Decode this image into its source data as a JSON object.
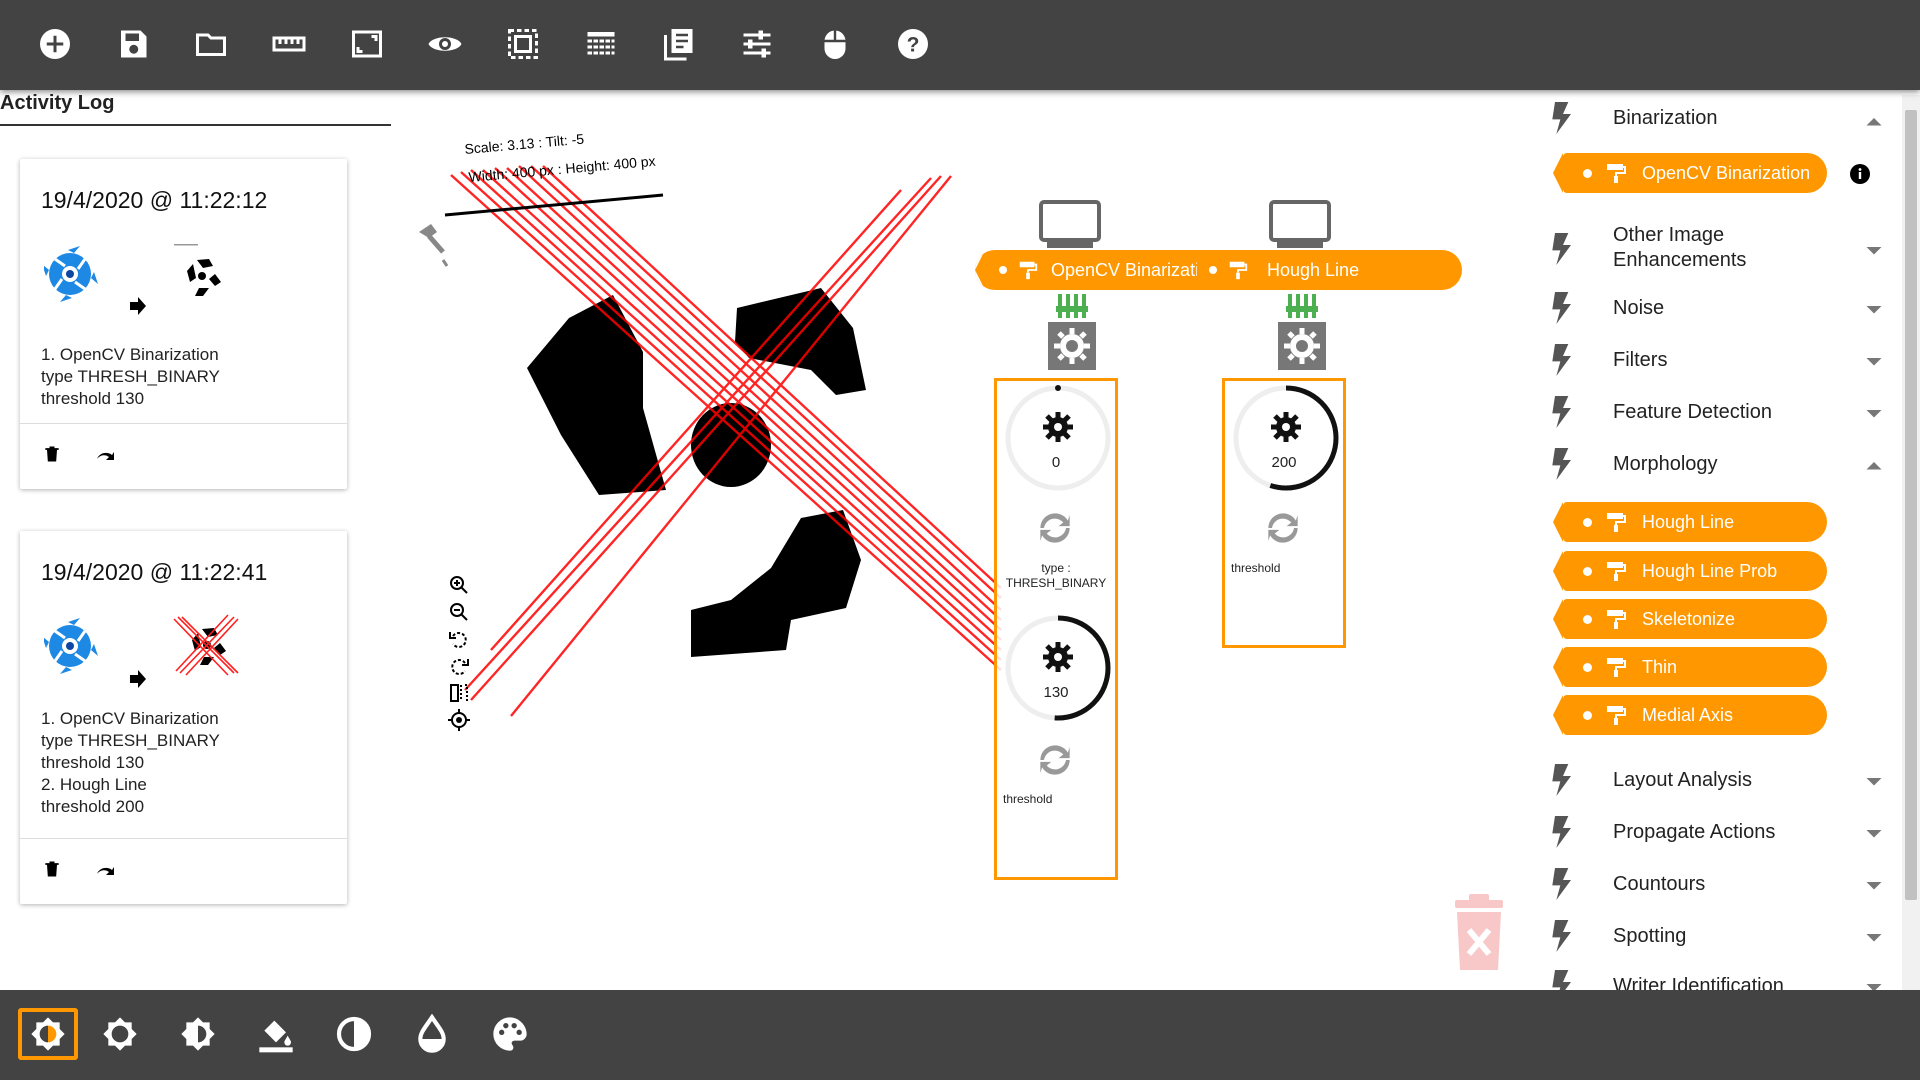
{
  "colors": {
    "accent": "#ff9800",
    "toolbar": "#434343",
    "connector": "#4caf50",
    "lines": "#ff0000"
  },
  "toolbar": {
    "icons": [
      "add-circle",
      "save",
      "folder",
      "ruler",
      "crop-frame",
      "eye",
      "select-dashed",
      "layers-lines",
      "document-list",
      "tune-sliders",
      "mouse",
      "help-circle"
    ]
  },
  "activity_log": {
    "title": "Activity Log",
    "entries": [
      {
        "date": "19/4/2020 @ 11:22:12",
        "steps": [
          "1. OpenCV Binarization",
          "type THRESH_BINARY",
          "threshold 130"
        ]
      },
      {
        "date": "19/4/2020 @ 11:22:41",
        "steps": [
          "1. OpenCV Binarization",
          "type THRESH_BINARY",
          "threshold 130",
          "2. Hough Line",
          "threshold 200"
        ]
      }
    ]
  },
  "canvas": {
    "scale_info_line1": "Scale: 3.13 : Tilt: -5",
    "scale_info_line2": "Width: 400 px : Height: 400 px",
    "pipeline": [
      {
        "label": "OpenCV Binarizatic",
        "params": [
          {
            "value": "0",
            "fraction": 0.0,
            "label_line1": "type :",
            "label_line2": "THRESH_BINARY"
          },
          {
            "value": "130",
            "fraction": 0.51,
            "label_line1": "threshold",
            "label_line2": ""
          }
        ]
      },
      {
        "label": "Hough Line",
        "params": [
          {
            "value": "200",
            "fraction": 0.55,
            "label_line1": "threshold",
            "label_line2": ""
          }
        ]
      }
    ],
    "zoom_tools": [
      "zoom-in",
      "zoom-out",
      "rotate-left",
      "rotate-right",
      "flip",
      "center-target"
    ]
  },
  "sidebar": {
    "categories": [
      {
        "name": "Binarization",
        "expanded": true,
        "items": [
          "OpenCV Binarization"
        ]
      },
      {
        "name": "Other Image Enhancements",
        "line1": "Other Image",
        "line2": "Enhancements",
        "expanded": false
      },
      {
        "name": "Noise",
        "expanded": false
      },
      {
        "name": "Filters",
        "expanded": false
      },
      {
        "name": "Feature Detection",
        "expanded": false
      },
      {
        "name": "Morphology",
        "expanded": true,
        "items": [
          "Hough Line",
          "Hough Line Prob",
          "Skeletonize",
          "Thin",
          "Medial Axis"
        ]
      },
      {
        "name": "Layout Analysis",
        "expanded": false
      },
      {
        "name": "Propagate Actions",
        "expanded": false
      },
      {
        "name": "Countours",
        "expanded": false
      },
      {
        "name": "Spotting",
        "expanded": false
      },
      {
        "name": "Writer Identification",
        "expanded": false
      }
    ]
  },
  "bottombar": {
    "icons": [
      "brightness-contrast",
      "brightness",
      "contrast-half",
      "fill-color",
      "invert",
      "opacity-drop",
      "palette"
    ],
    "active": "brightness-contrast"
  }
}
